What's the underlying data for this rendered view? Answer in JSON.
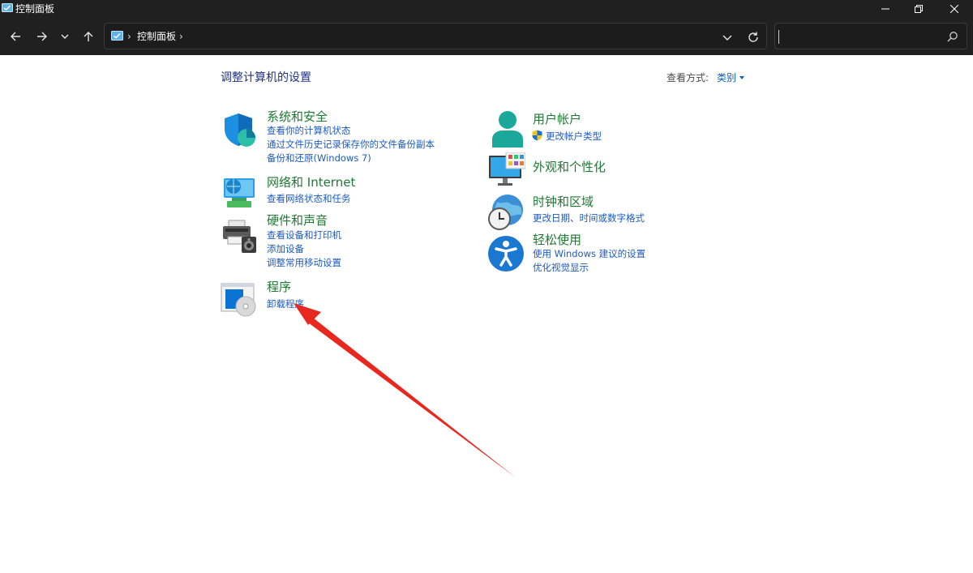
{
  "window": {
    "title": "控制面板",
    "controls": [
      "minimize-icon",
      "restore-icon",
      "close-icon"
    ]
  },
  "nav": {
    "icons": [
      "back-arrow-icon",
      "forward-arrow-icon",
      "recent-locations-chevron-icon",
      "up-arrow-icon"
    ]
  },
  "address": {
    "crumbs": [
      "控制面板"
    ],
    "dropdown_icon": "chevron-down-icon",
    "refresh_icon": "refresh-icon"
  },
  "search": {
    "value": "",
    "icon": "search-icon"
  },
  "content": {
    "heading": "调整计算机的设置",
    "view_by_label": "查看方式:",
    "view_by_value": "类别",
    "categories": [
      {
        "title": "系统和安全",
        "icon": "shield-icon",
        "links": [
          "查看你的计算机状态",
          "通过文件历史记录保存你的文件备份副本",
          "备份和还原(Windows 7)"
        ]
      },
      {
        "title": "网络和 Internet",
        "icon": "network-globe-icon",
        "links": [
          "查看网络状态和任务"
        ]
      },
      {
        "title": "硬件和声音",
        "icon": "printer-speaker-icon",
        "links": [
          "查看设备和打印机",
          "添加设备",
          "调整常用移动设置"
        ]
      },
      {
        "title": "程序",
        "icon": "programs-disc-icon",
        "links": [
          "卸载程序"
        ]
      },
      {
        "title": "用户帐户",
        "icon": "user-icon",
        "links": [
          "更改帐户类型"
        ],
        "link_icon": "uac-shield-icon"
      },
      {
        "title": "外观和个性化",
        "icon": "monitor-palette-icon",
        "links": []
      },
      {
        "title": "时钟和区域",
        "icon": "clock-globe-icon",
        "links": [
          "更改日期、时间或数字格式"
        ]
      },
      {
        "title": "轻松使用",
        "icon": "accessibility-icon",
        "links": [
          "使用 Windows 建议的设置",
          "优化视觉显示"
        ]
      }
    ]
  },
  "annotation": {
    "icon": "red-arrow-icon",
    "color": "#e8281e"
  },
  "colors": {
    "titlebar_bg": "#202020",
    "heading": "#1e3287",
    "category_title": "#1e7a32",
    "link": "#1e5bbf"
  }
}
